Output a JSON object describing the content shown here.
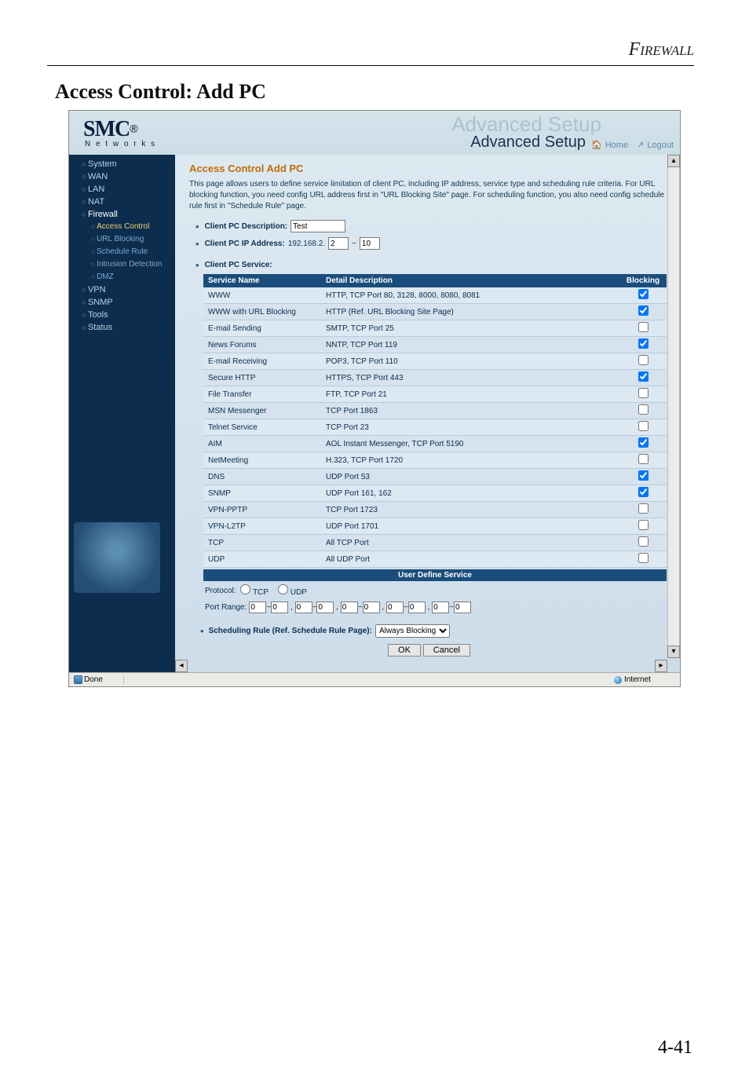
{
  "doc_header": "Firewall",
  "page_heading": "Access Control: Add PC",
  "page_number": "4-41",
  "topbar": {
    "logo_main": "SMC",
    "logo_sup": "®",
    "logo_sub": "N e t w o r k s",
    "ghost": "Advanced Setup",
    "adv": "Advanced Setup",
    "home": "Home",
    "logout": "Logout"
  },
  "sidebar": {
    "items": [
      {
        "label": "System"
      },
      {
        "label": "WAN"
      },
      {
        "label": "LAN"
      },
      {
        "label": "NAT"
      },
      {
        "label": "Firewall",
        "white": true
      }
    ],
    "subs": [
      {
        "label": "Access Control",
        "active": true
      },
      {
        "label": "URL Blocking"
      },
      {
        "label": "Schedule Rule"
      },
      {
        "label": "Intrusion Detection"
      },
      {
        "label": "DMZ"
      }
    ],
    "items2": [
      {
        "label": "VPN"
      },
      {
        "label": "SNMP"
      },
      {
        "label": "Tools"
      },
      {
        "label": "Status"
      }
    ]
  },
  "content": {
    "title": "Access Control Add PC",
    "intro": "This page allows users to define service limitation of client PC, including IP address, service type and scheduling rule criteria. For URL blocking function, you need config URL address first in \"URL Blocking Site\" page. For scheduling function, you also need config schedule rule first in \"Schedule Rule\" page.",
    "desc_label": "Client PC Description:",
    "desc_value": "Test",
    "ip_label": "Client PC IP Address:",
    "ip_prefix": "192.168.2.",
    "ip_from": "2",
    "ip_to": "10",
    "svc_label": "Client PC Service:",
    "th_service": "Service Name",
    "th_detail": "Detail Description",
    "th_block": "Blocking",
    "rows": [
      {
        "svc": "WWW",
        "detail": "HTTP, TCP Port 80, 3128, 8000, 8080, 8081",
        "blk": true
      },
      {
        "svc": "WWW with URL Blocking",
        "detail": "HTTP (Ref. URL Blocking Site Page)",
        "blk": true
      },
      {
        "svc": "E-mail Sending",
        "detail": "SMTP, TCP Port 25",
        "blk": false
      },
      {
        "svc": "News Forums",
        "detail": "NNTP, TCP Port 119",
        "blk": true
      },
      {
        "svc": "E-mail Receiving",
        "detail": "POP3, TCP Port 110",
        "blk": false
      },
      {
        "svc": "Secure HTTP",
        "detail": "HTTPS, TCP Port 443",
        "blk": true
      },
      {
        "svc": "File Transfer",
        "detail": "FTP, TCP Port 21",
        "blk": false
      },
      {
        "svc": "MSN Messenger",
        "detail": "TCP Port 1863",
        "blk": false
      },
      {
        "svc": "Telnet Service",
        "detail": "TCP Port 23",
        "blk": false
      },
      {
        "svc": "AIM",
        "detail": "AOL Instant Messenger, TCP Port 5190",
        "blk": true
      },
      {
        "svc": "NetMeeting",
        "detail": "H.323, TCP Port 1720",
        "blk": false
      },
      {
        "svc": "DNS",
        "detail": "UDP Port 53",
        "blk": true
      },
      {
        "svc": "SNMP",
        "detail": "UDP Port 161, 162",
        "blk": true
      },
      {
        "svc": "VPN-PPTP",
        "detail": "TCP Port 1723",
        "blk": false
      },
      {
        "svc": "VPN-L2TP",
        "detail": "UDP Port 1701",
        "blk": false
      },
      {
        "svc": "TCP",
        "detail": "All TCP Port",
        "blk": false
      },
      {
        "svc": "UDP",
        "detail": "All UDP Port",
        "blk": false
      }
    ],
    "uds_title": "User Define Service",
    "protocol_label": "Protocol:",
    "proto_tcp": "TCP",
    "proto_udp": "UDP",
    "port_label": "Port Range:",
    "port_zero": "0",
    "sched_label": "Scheduling Rule (Ref. Schedule Rule Page):",
    "sched_value": "Always Blocking",
    "ok": "OK",
    "cancel": "Cancel"
  },
  "statusbar": {
    "done": "Done",
    "zone": "Internet"
  }
}
